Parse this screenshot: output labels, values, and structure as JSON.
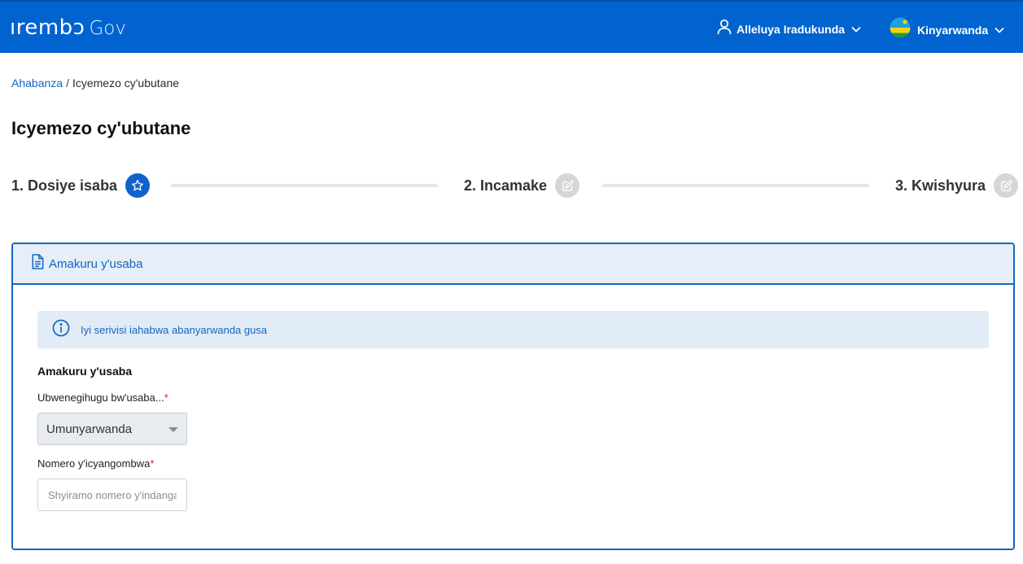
{
  "header": {
    "logo_main": "ırembɔ",
    "logo_sub": "Gov",
    "user_name": "Alleluya Iradukunda",
    "language": "Kinyarwanda",
    "brand_color": "#0063cf"
  },
  "breadcrumb": {
    "home": "Ahabanza",
    "separator": "/",
    "current": "Icyemezo cy'ubutane"
  },
  "page_title": "Icyemezo cy'ubutane",
  "stepper": {
    "steps": [
      {
        "label": "1. Dosiye isaba",
        "icon": "star-icon",
        "state": "active"
      },
      {
        "label": "2. Incamake",
        "icon": "edit-icon",
        "state": "inactive"
      },
      {
        "label": "3. Kwishyura",
        "icon": "edit-icon",
        "state": "inactive"
      }
    ]
  },
  "panel": {
    "title": "Amakuru y'usaba",
    "info_text": "Iyi serivisi iahabwa abanyarwanda gusa",
    "section_title": "Amakuru y'usaba",
    "nationality": {
      "label": "Ubwenegihugu bw'usaba...",
      "required_mark": "*",
      "value": "Umunyarwanda"
    },
    "id_number": {
      "label": "Nomero y'icyangombwa",
      "required_mark": "*",
      "placeholder": "Shyiramo nomero y'indangamuntu",
      "value": ""
    }
  }
}
